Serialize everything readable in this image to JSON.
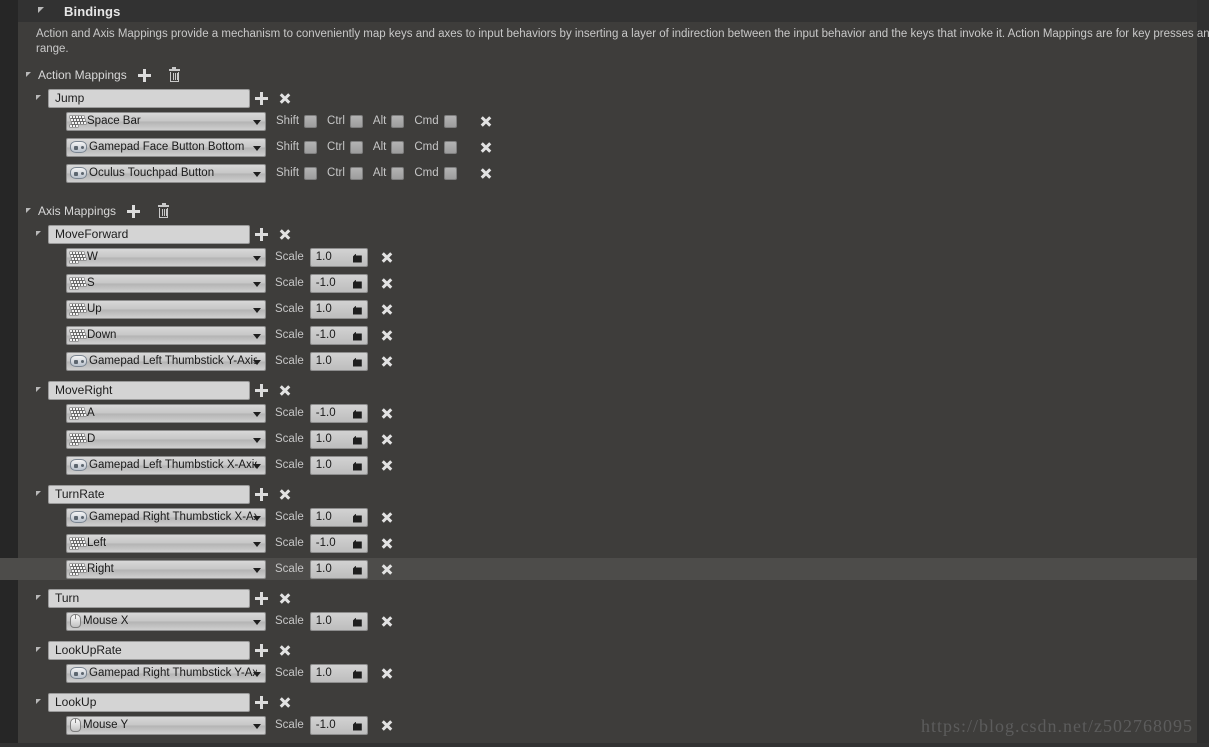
{
  "header": {
    "title": "Bindings",
    "expander_icon": "triangle-expanded-icon"
  },
  "description": {
    "line1": "Action and Axis Mappings provide a mechanism to conveniently map keys and axes to input behaviors by inserting a layer of indirection between the input behavior and the keys that invoke it. Action Mappings are for key presses and",
    "line2": "range."
  },
  "toolbar_icons": {
    "add": "plus-icon",
    "delete": "trash-icon",
    "remove": "cross-icon",
    "dropdown": "chevron-down-icon"
  },
  "modifier_labels": [
    "Shift",
    "Ctrl",
    "Alt",
    "Cmd"
  ],
  "scale_label": "Scale",
  "sections": [
    {
      "title": "Action Mappings",
      "type": "action",
      "mappings": [
        {
          "name": "Jump",
          "bindings": [
            {
              "key": "Space Bar",
              "icon": "keyboard-icon",
              "shift": false,
              "ctrl": false,
              "alt": false,
              "cmd": false
            },
            {
              "key": "Gamepad Face Button Bottom",
              "icon": "gamepad-icon",
              "shift": false,
              "ctrl": false,
              "alt": false,
              "cmd": false
            },
            {
              "key": "Oculus Touchpad Button",
              "icon": "gamepad-icon",
              "shift": false,
              "ctrl": false,
              "alt": false,
              "cmd": false
            }
          ]
        }
      ]
    },
    {
      "title": "Axis Mappings",
      "type": "axis",
      "mappings": [
        {
          "name": "MoveForward",
          "bindings": [
            {
              "key": "W",
              "icon": "keyboard-icon",
              "scale": "1.0"
            },
            {
              "key": "S",
              "icon": "keyboard-icon",
              "scale": "-1.0"
            },
            {
              "key": "Up",
              "icon": "keyboard-icon",
              "scale": "1.0"
            },
            {
              "key": "Down",
              "icon": "keyboard-icon",
              "scale": "-1.0"
            },
            {
              "key": "Gamepad Left Thumbstick Y-Axis",
              "icon": "gamepad-icon",
              "scale": "1.0"
            }
          ]
        },
        {
          "name": "MoveRight",
          "bindings": [
            {
              "key": "A",
              "icon": "keyboard-icon",
              "scale": "-1.0"
            },
            {
              "key": "D",
              "icon": "keyboard-icon",
              "scale": "1.0"
            },
            {
              "key": "Gamepad Left Thumbstick X-Axis",
              "icon": "gamepad-icon",
              "scale": "1.0"
            }
          ]
        },
        {
          "name": "TurnRate",
          "bindings": [
            {
              "key": "Gamepad Right Thumbstick X-Axis",
              "icon": "gamepad-icon",
              "scale": "1.0"
            },
            {
              "key": "Left",
              "icon": "keyboard-icon",
              "scale": "-1.0"
            },
            {
              "key": "Right",
              "icon": "keyboard-icon",
              "scale": "1.0",
              "highlighted": true
            }
          ]
        },
        {
          "name": "Turn",
          "bindings": [
            {
              "key": "Mouse X",
              "icon": "mouse-icon",
              "scale": "1.0"
            }
          ]
        },
        {
          "name": "LookUpRate",
          "bindings": [
            {
              "key": "Gamepad Right Thumbstick Y-Axis",
              "icon": "gamepad-icon",
              "scale": "1.0"
            }
          ]
        },
        {
          "name": "LookUp",
          "bindings": [
            {
              "key": "Mouse Y",
              "icon": "mouse-icon",
              "scale": "-1.0"
            }
          ]
        }
      ]
    }
  ],
  "watermark": "https://blog.csdn.net/z502768095",
  "colors": {
    "panel_bg": "#3e3d3b",
    "header_bg": "#323232",
    "field_bg": "#d4d4d4",
    "highlight_row": "#4d4c4a",
    "text": "#c9c9c9"
  }
}
